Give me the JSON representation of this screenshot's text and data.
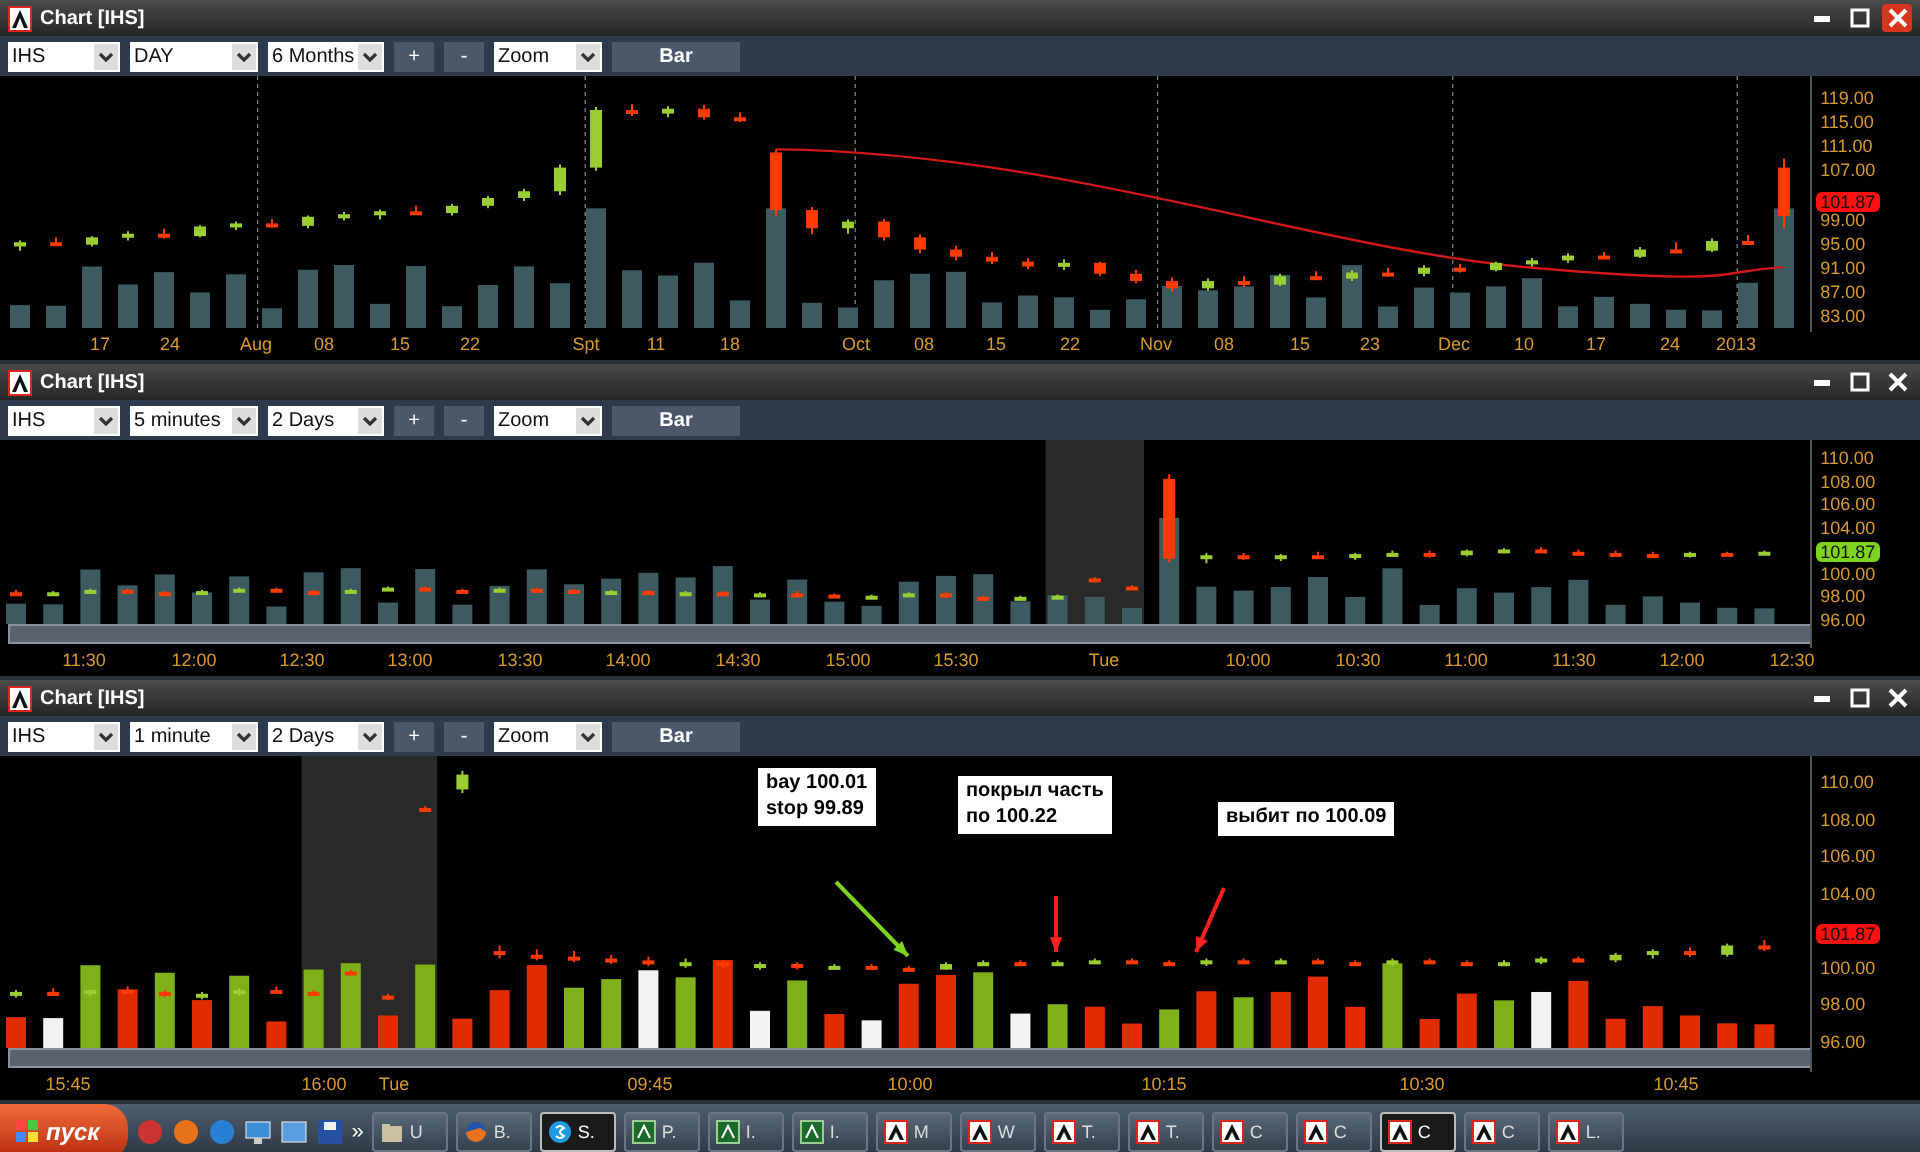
{
  "windows": [
    {
      "title": "Chart [IHS]",
      "close_highlight": true,
      "toolbar": {
        "symbol": "IHS",
        "interval": "DAY",
        "range": "6 Months",
        "zoom_in": "+",
        "zoom_out": "-",
        "mode": "Zoom",
        "style": "Bar"
      },
      "price_badge": {
        "text": "101.87",
        "color": "#ff1010"
      },
      "chart_data": {
        "type": "candlestick",
        "ohlc": [
          [
            94.5,
            95.5,
            93.8,
            95.2
          ],
          [
            95.2,
            96,
            94.6,
            94.8
          ],
          [
            94.8,
            96.2,
            94.5,
            96
          ],
          [
            96,
            97,
            95.5,
            96.6
          ],
          [
            96.6,
            97.4,
            95.8,
            96.2
          ],
          [
            96.2,
            98,
            96,
            97.8
          ],
          [
            97.8,
            98.6,
            97.2,
            98.3
          ],
          [
            98.3,
            99,
            97.6,
            97.9
          ],
          [
            97.9,
            99.6,
            97.5,
            99.4
          ],
          [
            99.4,
            100.2,
            98.8,
            99.8
          ],
          [
            99.8,
            100.6,
            99,
            100.3
          ],
          [
            100.3,
            101.2,
            99.8,
            100
          ],
          [
            100,
            101.5,
            99.6,
            101.2
          ],
          [
            101.2,
            102.8,
            100.8,
            102.5
          ],
          [
            102.5,
            104,
            102,
            103.6
          ],
          [
            103.6,
            108,
            103,
            107.5
          ],
          [
            107.5,
            117.5,
            107,
            117
          ],
          [
            117,
            118,
            116,
            116.4
          ],
          [
            116.4,
            117.6,
            115.8,
            117.2
          ],
          [
            117.2,
            117.8,
            115.4,
            115.8
          ],
          [
            115.8,
            116.6,
            115,
            115.6
          ],
          [
            110,
            110.5,
            99.5,
            100.5
          ],
          [
            100.5,
            101,
            96.5,
            97.5
          ],
          [
            97.5,
            99,
            96.6,
            98.6
          ],
          [
            98.6,
            99,
            95.5,
            96
          ],
          [
            96,
            96.5,
            93.4,
            94
          ],
          [
            94,
            94.6,
            92.2,
            92.8
          ],
          [
            92.8,
            93.6,
            91.6,
            92
          ],
          [
            92,
            92.6,
            90.8,
            91.2
          ],
          [
            91.2,
            92.4,
            90.6,
            91.8
          ],
          [
            91.8,
            92,
            89.6,
            90
          ],
          [
            90,
            90.6,
            88.4,
            88.8
          ],
          [
            88.8,
            89.4,
            87,
            87.6
          ],
          [
            87.6,
            89.2,
            87.2,
            88.8
          ],
          [
            88.8,
            89.6,
            87.8,
            88.2
          ],
          [
            88.2,
            90,
            88,
            89.6
          ],
          [
            89.6,
            90.4,
            89,
            89.2
          ],
          [
            89.2,
            90.6,
            88.8,
            90.2
          ],
          [
            90.2,
            91,
            89.6,
            90
          ],
          [
            90,
            91.4,
            89.6,
            91
          ],
          [
            91,
            91.6,
            90.2,
            90.6
          ],
          [
            90.6,
            92,
            90.4,
            91.8
          ],
          [
            91.8,
            92.6,
            91.2,
            92.2
          ],
          [
            92.2,
            93.4,
            91.8,
            93
          ],
          [
            93,
            93.6,
            92.4,
            92.8
          ],
          [
            92.8,
            94.4,
            92.6,
            94
          ],
          [
            94,
            95.2,
            93.6,
            93.8
          ],
          [
            93.8,
            95.8,
            93.6,
            95.4
          ],
          [
            95.4,
            96.4,
            94.8,
            95
          ],
          [
            107.5,
            109,
            97.5,
            99.5
          ]
        ],
        "yticks": [
          {
            "value": 119,
            "label": "119.00"
          },
          {
            "value": 115,
            "label": "115.00"
          },
          {
            "value": 111,
            "label": "111.00"
          },
          {
            "value": 107,
            "label": "107.00"
          },
          {
            "value": 99,
            "label": "99.00"
          },
          {
            "value": 95,
            "label": "95.00"
          },
          {
            "value": 91,
            "label": "91.00"
          },
          {
            "value": 87,
            "label": "87.00"
          },
          {
            "value": 83,
            "label": "83.00"
          }
        ],
        "ylim": [
          80.4,
          122.6
        ]
      },
      "x_labels": [
        "17",
        "24",
        "Aug",
        "08",
        "15",
        "22",
        "Spt",
        "11",
        "18",
        "Oct",
        "08",
        "15",
        "22",
        "Nov",
        "08",
        "15",
        "23",
        "Dec",
        "10",
        "17",
        "24",
        "2013"
      ]
    },
    {
      "title": "Chart [IHS]",
      "close_highlight": false,
      "toolbar": {
        "symbol": "IHS",
        "interval": "5 minutes",
        "range": "2 Days",
        "zoom_in": "+",
        "zoom_out": "-",
        "mode": "Zoom",
        "style": "Bar"
      },
      "price_badge": {
        "text": "101.87",
        "color": "#7ed321"
      },
      "chart_data": {
        "type": "candlestick",
        "ohlc": [
          [
            98.4,
            98.6,
            98.2,
            98.3
          ],
          [
            98.3,
            98.5,
            98.1,
            98.4
          ],
          [
            98.4,
            98.7,
            98.3,
            98.6
          ],
          [
            98.6,
            98.7,
            98.3,
            98.4
          ],
          [
            98.4,
            98.5,
            98.2,
            98.3
          ],
          [
            98.3,
            98.6,
            98.2,
            98.5
          ],
          [
            98.5,
            98.8,
            98.4,
            98.7
          ],
          [
            98.7,
            98.8,
            98.4,
            98.5
          ],
          [
            98.5,
            98.6,
            98.3,
            98.4
          ],
          [
            98.4,
            98.7,
            98.3,
            98.6
          ],
          [
            98.6,
            98.9,
            98.5,
            98.8
          ],
          [
            98.8,
            98.9,
            98.5,
            98.6
          ],
          [
            98.6,
            98.7,
            98.4,
            98.5
          ],
          [
            98.5,
            98.8,
            98.4,
            98.7
          ],
          [
            98.7,
            98.8,
            98.5,
            98.6
          ],
          [
            98.6,
            98.7,
            98.3,
            98.4
          ],
          [
            98.4,
            98.6,
            98.2,
            98.5
          ],
          [
            98.5,
            98.6,
            98.2,
            98.3
          ],
          [
            98.3,
            98.5,
            98.1,
            98.4
          ],
          [
            98.4,
            98.5,
            98.1,
            98.2
          ],
          [
            98.2,
            98.4,
            98,
            98.3
          ],
          [
            98.3,
            98.5,
            98.1,
            98.2
          ],
          [
            98.2,
            98.3,
            97.9,
            98
          ],
          [
            98,
            98.2,
            97.8,
            98.1
          ],
          [
            98.1,
            98.4,
            98,
            98.3
          ],
          [
            98.3,
            98.4,
            97.9,
            98
          ],
          [
            98,
            98.1,
            97.7,
            97.8
          ],
          [
            97.8,
            98.1,
            97.7,
            98
          ],
          [
            98,
            98.2,
            97.9,
            98.1
          ],
          [
            99.6,
            99.7,
            99.4,
            99.5
          ],
          [
            98.9,
            99,
            98.7,
            98.8
          ],
          [
            108.2,
            108.6,
            101,
            101.3
          ],
          [
            101.3,
            101.8,
            100.9,
            101.6
          ],
          [
            101.6,
            101.8,
            101.2,
            101.4
          ],
          [
            101.4,
            101.7,
            101.1,
            101.6
          ],
          [
            101.6,
            101.9,
            101.3,
            101.5
          ],
          [
            101.5,
            101.8,
            101.2,
            101.7
          ],
          [
            101.7,
            102,
            101.5,
            101.8
          ],
          [
            101.8,
            102,
            101.4,
            101.6
          ],
          [
            101.6,
            102.1,
            101.5,
            102
          ],
          [
            102,
            102.2,
            101.8,
            102.1
          ],
          [
            102.1,
            102.3,
            101.8,
            101.9
          ],
          [
            101.9,
            102.1,
            101.6,
            101.8
          ],
          [
            101.8,
            102,
            101.5,
            101.7
          ],
          [
            101.7,
            101.9,
            101.5,
            101.6
          ],
          [
            101.6,
            101.9,
            101.4,
            101.8
          ],
          [
            101.8,
            101.9,
            101.5,
            101.7
          ],
          [
            101.7,
            102,
            101.6,
            101.9
          ]
        ],
        "yticks": [
          {
            "value": 110,
            "label": "110.00"
          },
          {
            "value": 108,
            "label": "108.00"
          },
          {
            "value": 106,
            "label": "106.00"
          },
          {
            "value": 104,
            "label": "104.00"
          },
          {
            "value": 100,
            "label": "100.00"
          },
          {
            "value": 98,
            "label": "98.00"
          },
          {
            "value": 96,
            "label": "96.00"
          }
        ],
        "ylim": [
          93.58,
          111.56
        ]
      },
      "x_labels": [
        "11:30",
        "12:00",
        "12:30",
        "13:00",
        "13:30",
        "14:00",
        "14:30",
        "15:00",
        "15:30",
        "Tue",
        "10:00",
        "10:30",
        "11:00",
        "11:30",
        "12:00",
        "12:30"
      ]
    },
    {
      "title": "Chart [IHS]",
      "close_highlight": false,
      "toolbar": {
        "symbol": "IHS",
        "interval": "1 minute",
        "range": "2 Days",
        "zoom_in": "+",
        "zoom_out": "-",
        "mode": "Zoom",
        "style": "Bar"
      },
      "price_badge": {
        "text": "101.87",
        "color": "#ff1010"
      },
      "chart_data": {
        "type": "candlestick",
        "ohlc": [
          [
            98.6,
            98.8,
            98.4,
            98.7
          ],
          [
            98.7,
            98.9,
            98.5,
            98.6
          ],
          [
            98.6,
            98.8,
            98.5,
            98.8
          ],
          [
            98.8,
            99,
            98.6,
            98.7
          ],
          [
            98.7,
            98.8,
            98.4,
            98.5
          ],
          [
            98.5,
            98.7,
            98.3,
            98.6
          ],
          [
            98.6,
            98.9,
            98.5,
            98.8
          ],
          [
            98.8,
            99,
            98.6,
            98.7
          ],
          [
            98.7,
            98.8,
            98.5,
            98.6
          ],
          [
            99.8,
            99.9,
            99.6,
            99.7
          ],
          [
            98.5,
            98.6,
            98.3,
            98.4
          ],
          [
            108.6,
            108.7,
            108.4,
            108.5
          ],
          [
            109.6,
            110.6,
            109.4,
            110.4
          ],
          [
            100.9,
            101.2,
            100.5,
            100.7
          ],
          [
            100.7,
            101,
            100.4,
            100.6
          ],
          [
            100.6,
            100.9,
            100.3,
            100.5
          ],
          [
            100.5,
            100.7,
            100.2,
            100.4
          ],
          [
            100.4,
            100.6,
            100.1,
            100.2
          ],
          [
            100.2,
            100.5,
            100,
            100.3
          ],
          [
            100.3,
            100.4,
            100,
            100.1
          ],
          [
            100.1,
            100.3,
            99.9,
            100.2
          ],
          [
            100.2,
            100.3,
            99.9,
            100
          ],
          [
            100,
            100.2,
            99.9,
            100.1
          ],
          [
            100.1,
            100.2,
            99.9,
            100
          ],
          [
            100,
            100.1,
            99.8,
            99.9
          ],
          [
            99.9,
            100.3,
            99.9,
            100.2
          ],
          [
            100.2,
            100.4,
            100.1,
            100.3
          ],
          [
            100.3,
            100.4,
            100.1,
            100.2
          ],
          [
            100.2,
            100.4,
            100.1,
            100.3
          ],
          [
            100.3,
            100.5,
            100.2,
            100.4
          ],
          [
            100.4,
            100.5,
            100.2,
            100.3
          ],
          [
            100.3,
            100.4,
            100.1,
            100.2
          ],
          [
            100.2,
            100.5,
            100.1,
            100.4
          ],
          [
            100.4,
            100.5,
            100.2,
            100.3
          ],
          [
            100.3,
            100.5,
            100.2,
            100.4
          ],
          [
            100.4,
            100.5,
            100.2,
            100.3
          ],
          [
            100.3,
            100.4,
            100.1,
            100.2
          ],
          [
            100.2,
            100.5,
            100.1,
            100.4
          ],
          [
            100.4,
            100.5,
            100.2,
            100.3
          ],
          [
            100.3,
            100.4,
            100.1,
            100.2
          ],
          [
            100.2,
            100.4,
            100.1,
            100.3
          ],
          [
            100.3,
            100.6,
            100.2,
            100.5
          ],
          [
            100.5,
            100.6,
            100.3,
            100.4
          ],
          [
            100.4,
            100.8,
            100.3,
            100.7
          ],
          [
            100.7,
            101,
            100.5,
            100.9
          ],
          [
            100.9,
            101.1,
            100.6,
            100.7
          ],
          [
            100.7,
            101.3,
            100.6,
            101.2
          ],
          [
            101.2,
            101.5,
            100.9,
            101.1
          ]
        ],
        "yticks": [
          {
            "value": 110,
            "label": "110.00"
          },
          {
            "value": 108,
            "label": "108.00"
          },
          {
            "value": 106,
            "label": "106.00"
          },
          {
            "value": 104,
            "label": "104.00"
          },
          {
            "value": 100,
            "label": "100.00"
          },
          {
            "value": 98,
            "label": "98.00"
          },
          {
            "value": 96,
            "label": "96.00"
          }
        ],
        "ylim": [
          94.39,
          111.4
        ]
      },
      "x_labels": [
        "15:45",
        "16:00",
        "Tue",
        "09:45",
        "10:00",
        "10:15",
        "10:30",
        "10:45"
      ],
      "notes": [
        {
          "text": "bay 100.01\nstop 99.89",
          "color": "#7ed321"
        },
        {
          "text": "покрыл часть\nпо 100.22",
          "color": "#ff2020"
        },
        {
          "text": "выбит по 100.09",
          "color": "#ff2020"
        }
      ]
    }
  ],
  "taskbar": {
    "start": "пуск",
    "quick_launch": [
      {
        "kind": "globe"
      },
      {
        "kind": "globe"
      },
      {
        "kind": "globe"
      },
      {
        "kind": "monitor"
      },
      {
        "kind": "window"
      },
      {
        "kind": "disk"
      }
    ],
    "more": "»",
    "tasks": [
      {
        "label": "U",
        "kind": "folder",
        "selected": false
      },
      {
        "label": "B.",
        "kind": "browser",
        "selected": false
      },
      {
        "label": "S.",
        "kind": "skype",
        "selected": true
      },
      {
        "label": "P.",
        "kind": "app",
        "selected": false
      },
      {
        "label": "I.",
        "kind": "app",
        "selected": false
      },
      {
        "label": "I.",
        "kind": "app",
        "selected": false
      },
      {
        "label": "M",
        "kind": "chart",
        "selected": false
      },
      {
        "label": "W",
        "kind": "chart",
        "selected": false
      },
      {
        "label": "T.",
        "kind": "chart",
        "selected": false
      },
      {
        "label": "T.",
        "kind": "chart",
        "selected": false
      },
      {
        "label": "C",
        "kind": "chart",
        "selected": false
      },
      {
        "label": "C",
        "kind": "chart",
        "selected": false
      },
      {
        "label": "C",
        "kind": "chart",
        "selected": true
      },
      {
        "label": "C",
        "kind": "chart",
        "selected": false
      },
      {
        "label": "L.",
        "kind": "chart",
        "selected": false
      }
    ]
  }
}
